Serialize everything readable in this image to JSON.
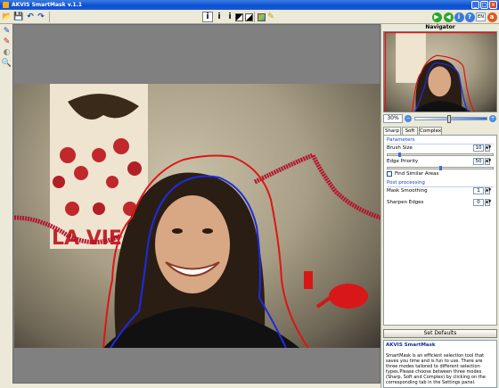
{
  "window": {
    "title": "AKVIS SmartMask v.1.1",
    "controls": [
      "_",
      "□",
      "×"
    ]
  },
  "toolbar": {
    "left_icons": [
      "open-image-icon",
      "save-image-icon",
      "undo-icon",
      "redo-icon"
    ],
    "mask_icons": [
      "show-mask-icon",
      "show-outline-icon",
      "show-info-icon",
      "show-bw-mask-icon",
      "show-inverted-icon",
      "background-icon",
      "color-icon"
    ],
    "right_icons": [
      "run-icon",
      "back-icon",
      "info-icon",
      "help-icon",
      "akvis-icon"
    ],
    "language": "EN"
  },
  "tools": [
    "pencil-tool-icon",
    "eraser-tool-icon",
    "blend-tool-icon",
    "zoom-tool-icon"
  ],
  "navigator": {
    "title": "Navigator",
    "zoom": "30%"
  },
  "settings": {
    "tabs": [
      "Sharp",
      "Soft",
      "Complex"
    ],
    "active_tab": "Sharp",
    "parameters_header": "Parameters",
    "brush_size_label": "Brush Size",
    "brush_size_value": "10",
    "brush_size_level": 0.1,
    "edge_priority_label": "Edge Priority",
    "edge_priority_value": "50",
    "edge_priority_level": 0.5,
    "find_similar_label": "Find Similar Areas",
    "post_header": "Post processing",
    "mask_smoothing_label": "Mask Smoothing",
    "mask_smoothing_value": "1",
    "sharpen_edges_label": "Sharpen Edges",
    "sharpen_edges_value": "0"
  },
  "set_defaults": "Set Defaults",
  "info": {
    "title": "AKVIS SmartMask",
    "text": "SmartMask is an efficient selection tool that saves you time and is fun to use. There are three modes tailored to different selection types.Please choose between three modes (Sharp, Soft and Complex) by clicking on the corresponding tab in the Settings panel."
  },
  "colors": {
    "outline_outer": "#e01414",
    "outline_inner": "#1e2be0",
    "accent": "#3b6bd6"
  }
}
